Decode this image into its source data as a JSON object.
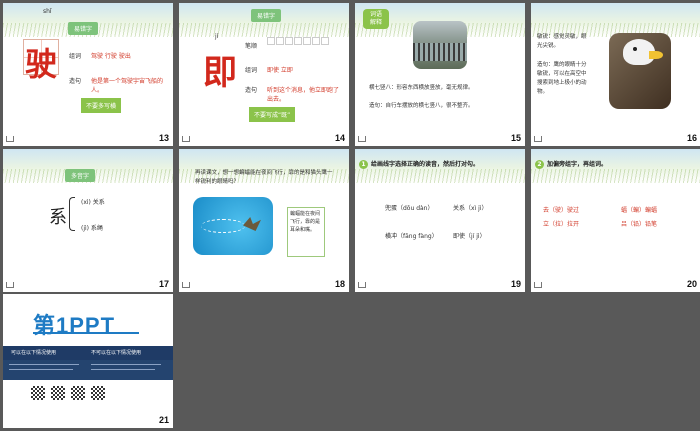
{
  "slides": [
    {
      "num": "13",
      "title": "易错字",
      "pinyin": "shǐ",
      "char": "驶",
      "row1_label": "组词",
      "row1_value": "驾驶 行驶 驶出",
      "row2_label": "造句",
      "row2_value": "他是第一个驾驶宇宙飞船的人。",
      "note": "不要多写横"
    },
    {
      "num": "14",
      "title": "易错字",
      "pinyin": "jí",
      "char": "即",
      "row1_label": "笔顺",
      "row2_label": "组词",
      "row2_value": "即使 立即",
      "row3_label": "造句",
      "row3_value": "听到这个消息，他立即跑了出去。",
      "note": "不要写成“既”"
    },
    {
      "num": "15",
      "badge": "词语解释",
      "line1": "横七竖八：形容东西横放竖放，毫无规律。",
      "line2": "造句：自行车摆放的横七竖八，很不整齐。"
    },
    {
      "num": "16",
      "p1": "敏锐：感觉灵敏，眼光尖锐。",
      "p2": "造句：鹰的眼睛十分敏锐，可以在高空中搜索到地上极小的动物。"
    },
    {
      "num": "17",
      "title": "多音字",
      "char": "系",
      "r1": "(xì) 关系",
      "r2": "(jì) 系绳"
    },
    {
      "num": "18",
      "question": "再读课文，想一想蝙蝠能在夜间飞行，靠的是和猫头鹰一样锐利的眼睛吗？",
      "answer": "蝙蝠能在夜间飞行，靠的是耳朵和嘴。"
    },
    {
      "num": "19",
      "qnum": "1",
      "heading": "给画线字选择正确的读音，然后打对勾。",
      "w1": "兜蛋（dōu dàn）",
      "w2": "关系（xì jì）",
      "w3": "横冲（fāng fàng）",
      "w4": "即使（jí jì）"
    },
    {
      "num": "20",
      "qnum": "2",
      "heading": "加偏旁组字，再组词。",
      "w1": "去（驶）驶过",
      "w2": "蝠（蝙）蝙蝠",
      "w3": "立（拉）拉开",
      "w4": "吕（铅）铅笔"
    },
    {
      "num": "21",
      "logo": "第1PPT",
      "col1": "可以在以下情况使用",
      "col2": "不可以在以下情况使用"
    }
  ]
}
